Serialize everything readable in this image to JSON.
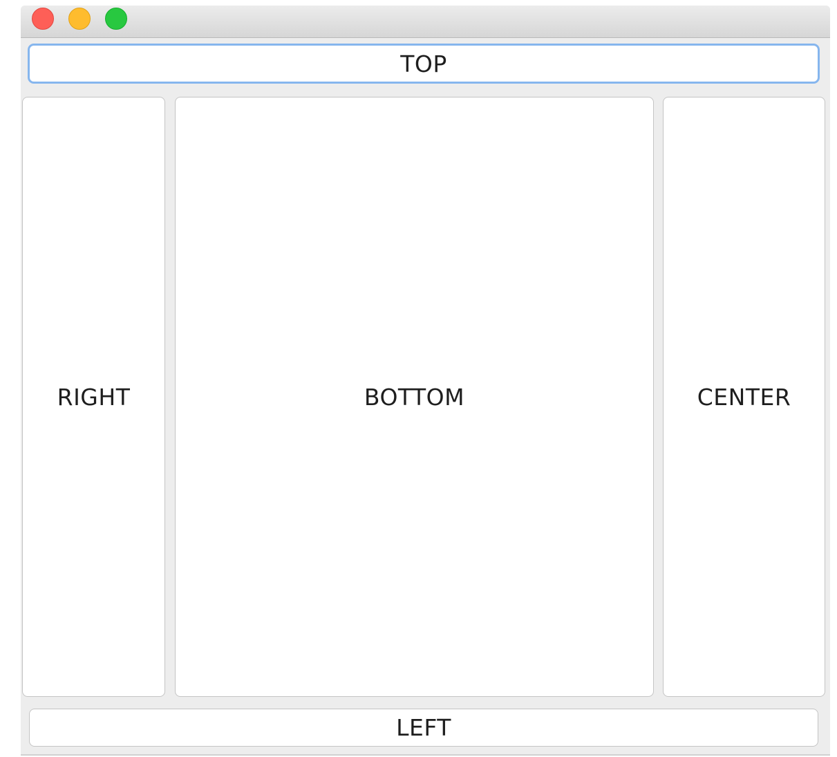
{
  "window": {
    "traffic_lights": {
      "close": {
        "icon": "close-traffic-light-icon",
        "color": "#fe5f57"
      },
      "minimize": {
        "icon": "minimize-traffic-light-icon",
        "color": "#febc2e"
      },
      "zoom": {
        "icon": "zoom-traffic-light-icon",
        "color": "#28c840"
      }
    }
  },
  "buttons": {
    "top": "TOP",
    "right": "RIGHT",
    "bottom": "BOTTOM",
    "center": "CENTER",
    "left": "LEFT"
  },
  "colors": {
    "focus_ring": "#86b6ee",
    "window_background": "#ededed",
    "button_background": "#ffffff"
  }
}
